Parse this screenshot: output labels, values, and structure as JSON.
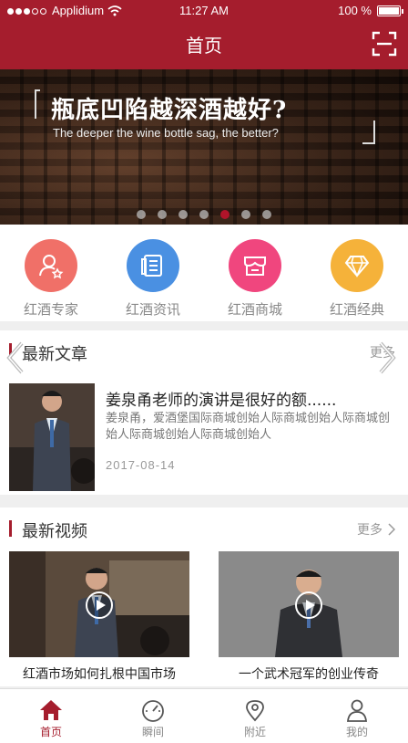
{
  "status_bar": {
    "carrier": "Applidium",
    "time": "11:27 AM",
    "battery": "100 %"
  },
  "header": {
    "title": "首页",
    "scan_icon": "scan-icon"
  },
  "banner": {
    "headline": "瓶底凹陷越深酒越好?",
    "subline": "The deeper the wine bottle sag, the better?",
    "slide_count": 7,
    "active_slide": 5
  },
  "categories": [
    {
      "label": "红酒专家",
      "icon": "expert-icon",
      "color": "#f07068"
    },
    {
      "label": "红酒资讯",
      "icon": "news-icon",
      "color": "#4a90e2"
    },
    {
      "label": "红酒商城",
      "icon": "store-icon",
      "color": "#f0467e"
    },
    {
      "label": "红酒经典",
      "icon": "diamond-icon",
      "color": "#f5b23a"
    }
  ],
  "articles_section": {
    "title": "最新文章",
    "more": "更多",
    "article": {
      "title": "姜泉甬老师的演讲是很好的额......",
      "desc": "姜泉甬，爱酒堡国际商城创始人际商城创始人际商城创始人际商城创始人际商城创始人",
      "date": "2017-08-14"
    }
  },
  "videos_section": {
    "title": "最新视频",
    "more": "更多",
    "videos": [
      {
        "caption": "红酒市场如何扎根中国市场"
      },
      {
        "caption": "一个武术冠军的创业传奇"
      }
    ]
  },
  "tabs": [
    {
      "label": "首页",
      "icon": "home-icon",
      "active": true
    },
    {
      "label": "瞬间",
      "icon": "gauge-icon",
      "active": false
    },
    {
      "label": "附近",
      "icon": "location-icon",
      "active": false
    },
    {
      "label": "我的",
      "icon": "user-icon",
      "active": false
    }
  ],
  "colors": {
    "brand": "#a51d2d",
    "active_dot": "#b0142a"
  }
}
